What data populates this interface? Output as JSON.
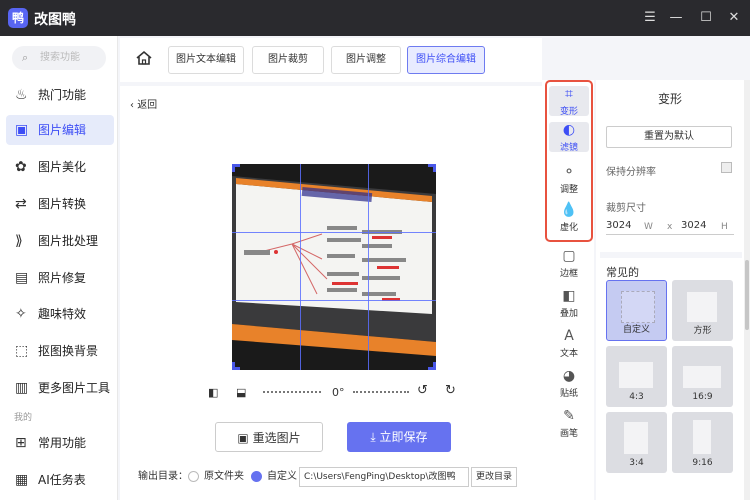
{
  "app": {
    "title": "改图鸭",
    "logo": "鸭"
  },
  "window": {
    "menu": "☰",
    "minimize": "—",
    "maximize": "☐",
    "close": "✕"
  },
  "sidebar": {
    "search_placeholder": "搜索功能",
    "items": [
      {
        "label": "热门功能",
        "icon": "flame-icon",
        "glyph": "♨"
      },
      {
        "label": "图片编辑",
        "icon": "image-edit-icon",
        "glyph": "▣"
      },
      {
        "label": "图片美化",
        "icon": "image-beautify-icon",
        "glyph": "✿"
      },
      {
        "label": "图片转换",
        "icon": "convert-icon",
        "glyph": "⇄"
      },
      {
        "label": "图片批处理",
        "icon": "batch-icon",
        "glyph": "⟫"
      },
      {
        "label": "照片修复",
        "icon": "photo-repair-icon",
        "glyph": "▤"
      },
      {
        "label": "趣味特效",
        "icon": "sparkle-icon",
        "glyph": "✧"
      },
      {
        "label": "抠图换背景",
        "icon": "cutout-icon",
        "glyph": "⬚"
      },
      {
        "label": "更多图片工具",
        "icon": "toolbox-icon",
        "glyph": "▥"
      }
    ],
    "section_mine": "我的",
    "mine_items": [
      {
        "label": "常用功能",
        "icon": "grid-icon",
        "glyph": "⊞"
      },
      {
        "label": "AI任务表",
        "icon": "ai-task-icon",
        "glyph": "▦"
      }
    ]
  },
  "tabs": [
    "图片文本编辑",
    "图片裁剪",
    "图片调整",
    "图片综合编辑"
  ],
  "active_tab": 3,
  "editor": {
    "back": "返回",
    "rotation": "0°",
    "reselect": "重选图片",
    "save": "立即保存",
    "output_label": "输出目录：",
    "opt_original": "原文件夹",
    "opt_custom": "自定义",
    "path": "C:\\Users\\FengPing\\Desktop\\改图鸭",
    "change_dir": "更改目录",
    "photo_title": "学习方式之知识的学习",
    "photo_subtitle": "—、"
  },
  "tools": [
    {
      "label": "变形",
      "icon": "crop-transform-icon",
      "glyph": "⌗"
    },
    {
      "label": "滤镜",
      "icon": "filter-icon",
      "glyph": "◐"
    },
    {
      "label": "调整",
      "icon": "adjust-icon",
      "glyph": "⚬"
    },
    {
      "label": "虚化",
      "icon": "blur-drop-icon",
      "glyph": "💧"
    },
    {
      "label": "边框",
      "icon": "frame-icon",
      "glyph": "▢"
    },
    {
      "label": "叠加",
      "icon": "overlay-icon",
      "glyph": "◧"
    },
    {
      "label": "文本",
      "icon": "text-icon",
      "glyph": "A"
    },
    {
      "label": "贴纸",
      "icon": "sticker-icon",
      "glyph": "◕"
    },
    {
      "label": "画笔",
      "icon": "brush-icon",
      "glyph": "✎"
    }
  ],
  "panel": {
    "title": "变形",
    "reset": "重置为默认",
    "keep_resolution": "保持分辨率",
    "crop_size": "裁剪尺寸",
    "width": "3024",
    "w_label": "W",
    "x_label": "x",
    "height": "3024",
    "h_label": "H",
    "common": "常见的",
    "presets": [
      "自定义",
      "方形",
      "4:3",
      "16:9",
      "3:4",
      "9:16"
    ]
  },
  "colors": {
    "accent": "#6672f0",
    "highlight": "#e8523f",
    "titlebar": "#2a2a2e"
  }
}
